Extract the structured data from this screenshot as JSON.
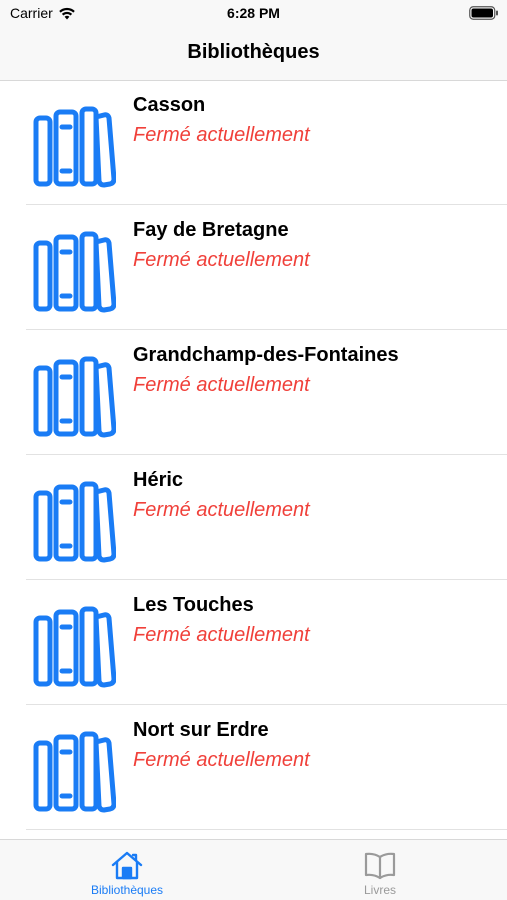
{
  "status_bar": {
    "carrier": "Carrier",
    "time": "6:28 PM",
    "wifi_icon": "wifi-icon",
    "battery_icon": "battery-icon"
  },
  "nav": {
    "title": "Bibliothèques"
  },
  "libraries": [
    {
      "name": "Casson",
      "status": "Fermé actuellement",
      "icon": "books-icon"
    },
    {
      "name": "Fay de Bretagne",
      "status": "Fermé actuellement",
      "icon": "books-icon"
    },
    {
      "name": "Grandchamp-des-Fontaines",
      "status": "Fermé actuellement",
      "icon": "books-icon"
    },
    {
      "name": "Héric",
      "status": "Fermé actuellement",
      "icon": "books-icon"
    },
    {
      "name": "Les Touches",
      "status": "Fermé actuellement",
      "icon": "books-icon"
    },
    {
      "name": "Nort sur Erdre",
      "status": "Fermé actuellement",
      "icon": "books-icon"
    }
  ],
  "tabs": [
    {
      "label": "Bibliothèques",
      "icon": "house-icon",
      "selected": true
    },
    {
      "label": "Livres",
      "icon": "book-icon",
      "selected": false
    }
  ],
  "colors": {
    "accent": "#1a7cf5",
    "closed_status": "#f0403a",
    "inactive_tab": "#9a9a9a"
  }
}
